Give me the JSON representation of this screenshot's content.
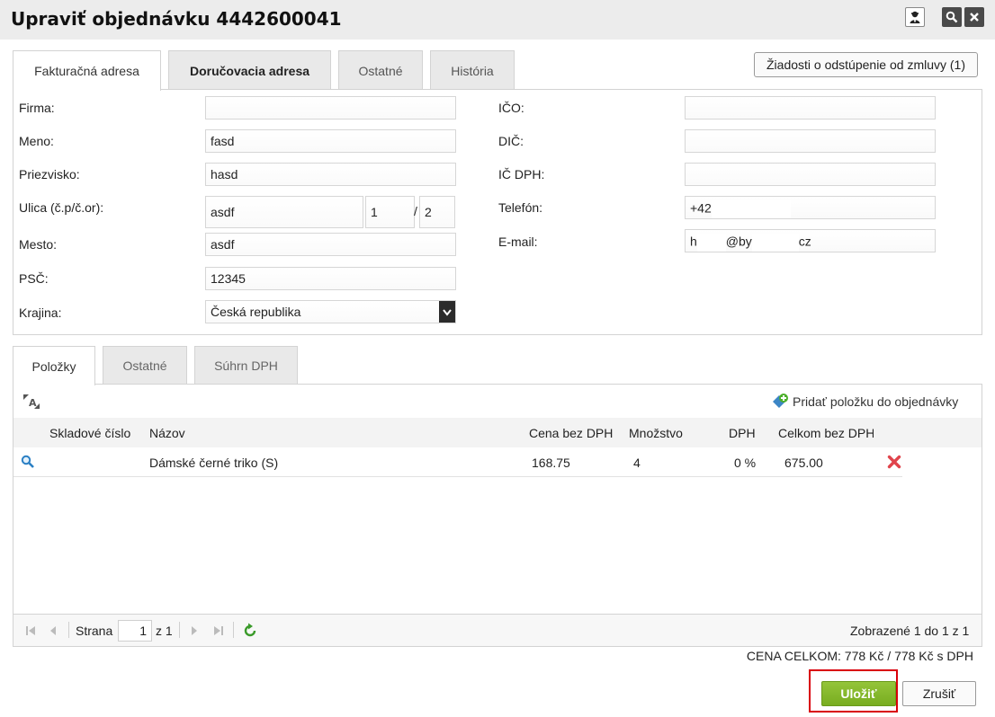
{
  "window": {
    "title": "Upraviť objednávku 4442600041"
  },
  "tabs_top": [
    {
      "label": "Fakturačná adresa"
    },
    {
      "label": "Doručovacia adresa"
    },
    {
      "label": "Ostatné"
    },
    {
      "label": "História"
    }
  ],
  "withdraw_button": "Žiadosti o odstúpenie od zmluvy (1)",
  "address": {
    "labels": {
      "firma": "Firma:",
      "meno": "Meno:",
      "priezvisko": "Priezvisko:",
      "ulica": "Ulica (č.p/č.or):",
      "mesto": "Mesto:",
      "psc": "PSČ:",
      "krajina": "Krajina:",
      "ico": "IČO:",
      "dic": "DIČ:",
      "icdph": "IČ DPH:",
      "telefon": "Telefón:",
      "email": "E-mail:"
    },
    "values": {
      "firma": "",
      "meno": "fasd",
      "priezvisko": "hasd",
      "ulica": "asdf",
      "cislo_popisne": "1",
      "cislo_separator": "/",
      "cislo_orientacne": "2",
      "mesto": "asdf",
      "psc": "12345",
      "krajina": "Česká republika",
      "ico": "",
      "dic": "",
      "icdph": "",
      "telefon": "+42",
      "email_part1": "h",
      "email_part2": "@by",
      "email_part3": "cz"
    }
  },
  "tabs_bottom": [
    {
      "label": "Položky"
    },
    {
      "label": "Ostatné"
    },
    {
      "label": "Súhrn DPH"
    }
  ],
  "items": {
    "add_label": "Pridať položku do objednávky",
    "columns": [
      "Skladové číslo",
      "Názov",
      "Cena bez DPH",
      "Množstvo",
      "DPH",
      "Celkom bez DPH"
    ],
    "rows": [
      {
        "sku": "",
        "name": "Dámské černé triko (S)",
        "price": "168.75",
        "qty": "4",
        "vat": "0 %",
        "total": "675.00"
      }
    ]
  },
  "pager": {
    "page_label": "Strana",
    "page_value": "1",
    "of_label": "z 1",
    "summary": "Zobrazené 1 do 1 z 1"
  },
  "total": "CENA CELKOM: 778 Kč / 778 Kč s DPH",
  "actions": {
    "save": "Uložiť",
    "cancel": "Zrušiť"
  },
  "colors": {
    "accent_green": "#84b82a",
    "highlight_red": "#d9000a",
    "delete_red": "#e0444c"
  },
  "icons": [
    "user-agent-icon",
    "search-icon",
    "close-icon",
    "resize-text-icon",
    "add-item-icon",
    "magnifier-icon",
    "delete-icon",
    "first-page-icon",
    "prev-page-icon",
    "next-page-icon",
    "last-page-icon",
    "refresh-icon",
    "select-arrow-icon"
  ]
}
